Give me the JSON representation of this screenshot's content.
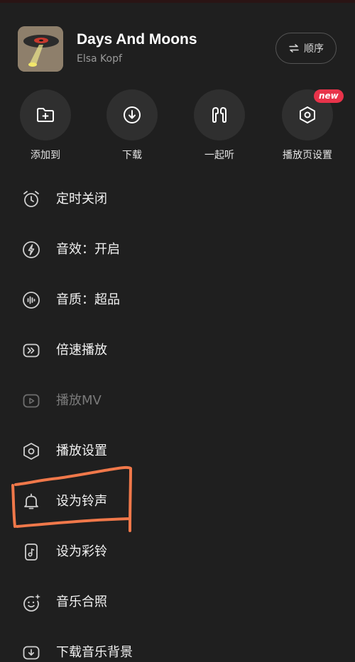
{
  "song": {
    "title": "Days And Moons",
    "artist": "Elsa Kopf",
    "order_label": "顺序"
  },
  "actions": [
    {
      "label": "添加到",
      "icon": "folder-add-icon"
    },
    {
      "label": "下载",
      "icon": "download-icon"
    },
    {
      "label": "一起听",
      "icon": "earbuds-icon"
    },
    {
      "label": "播放页设置",
      "icon": "hexagon-settings-icon",
      "badge": "new"
    }
  ],
  "menu": [
    {
      "label": "定时关闭",
      "icon": "alarm-clock-icon",
      "enabled": true
    },
    {
      "label": "音效：开启",
      "icon": "lightning-icon",
      "enabled": true
    },
    {
      "label": "音质：超品",
      "icon": "sound-quality-icon",
      "enabled": true
    },
    {
      "label": "倍速播放",
      "icon": "speed-play-icon",
      "enabled": true
    },
    {
      "label": "播放MV",
      "icon": "video-play-icon",
      "enabled": false
    },
    {
      "label": "播放设置",
      "icon": "hexagon-settings-icon",
      "enabled": true
    },
    {
      "label": "设为铃声",
      "icon": "bell-icon",
      "enabled": true
    },
    {
      "label": "设为彩铃",
      "icon": "phone-music-icon",
      "enabled": true
    },
    {
      "label": "音乐合照",
      "icon": "sparkle-face-icon",
      "enabled": true
    },
    {
      "label": "下载音乐背景",
      "icon": "download-video-icon",
      "enabled": true
    }
  ],
  "colors": {
    "background": "#1f1f1f",
    "badge": "#e8334a",
    "annotation": "#f0784a"
  }
}
